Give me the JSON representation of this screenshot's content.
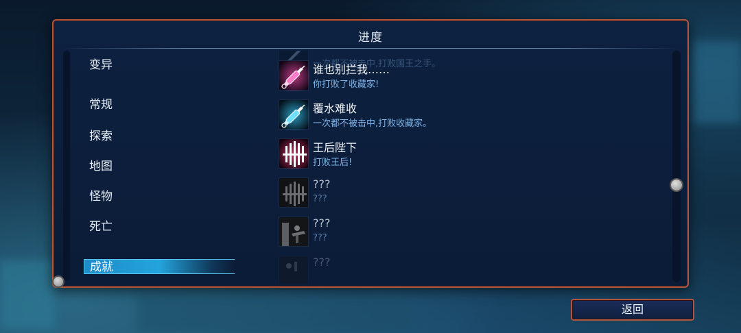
{
  "screen": {
    "title": "进度",
    "back_label": "返回"
  },
  "categories": [
    {
      "label": "变异",
      "active": false
    },
    {
      "label": "常规",
      "active": false
    },
    {
      "label": "探索",
      "active": false
    },
    {
      "label": "地图",
      "active": false
    },
    {
      "label": "怪物",
      "active": false
    },
    {
      "label": "死亡",
      "active": false
    },
    {
      "label": "成就",
      "active": true
    }
  ],
  "achievements": [
    {
      "name": "",
      "desc": "一次都不被击中,打败国王之手。",
      "icon": "partial-icon",
      "state": "faded"
    },
    {
      "name": "谁也别拦我……",
      "desc": "你打败了收藏家!",
      "icon": "pink-syringe-icon",
      "state": "unlocked"
    },
    {
      "name": "覆水难收",
      "desc": "一次都不被击中,打败收藏家。",
      "icon": "blue-syringe-icon",
      "state": "unlocked"
    },
    {
      "name": "王后陛下",
      "desc": "打败王后!",
      "icon": "queen-crown-icon",
      "state": "unlocked"
    },
    {
      "name": "???",
      "desc": "???",
      "icon": "locked-crown-icon",
      "state": "locked"
    },
    {
      "name": "???",
      "desc": "???",
      "icon": "locked-figure-icon",
      "state": "locked"
    },
    {
      "name": "???",
      "desc": "",
      "icon": "locked-partial-icon",
      "state": "faded"
    }
  ],
  "colors": {
    "panel_border": "#b2553f",
    "active_tab": "#23a4dc",
    "desc_text": "#7fb4e8"
  }
}
